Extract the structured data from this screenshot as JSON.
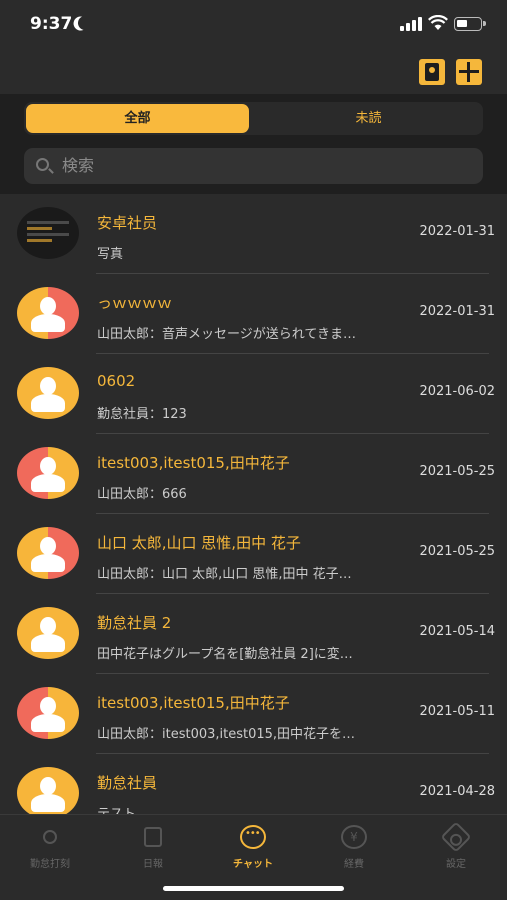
{
  "status": {
    "time": "9:37"
  },
  "segments": {
    "all": "全部",
    "unread": "未読"
  },
  "search": {
    "placeholder": "検索"
  },
  "chats": [
    {
      "title": "安卓社员",
      "subtitle": "写真",
      "date": "2022-01-31",
      "avatar": "photo"
    },
    {
      "title": "っｗｗｗｗ",
      "subtitle": "山田太郎：音声メッセージが送られてきま…",
      "date": "2022-01-31",
      "avatar": "split"
    },
    {
      "title": "0602",
      "subtitle": "勤怠社員：123",
      "date": "2021-06-02",
      "avatar": "orange"
    },
    {
      "title": "itest003,itest015,田中花子",
      "subtitle": "山田太郎：666",
      "date": "2021-05-25",
      "avatar": "split-red"
    },
    {
      "title": "山口 太郎,山口 思惟,田中 花子",
      "subtitle": "山田太郎：山口 太郎,山口 思惟,田中 花子…",
      "date": "2021-05-25",
      "avatar": "split"
    },
    {
      "title": "勤怠社員 2",
      "subtitle": "田中花子はグループ名を[勤怠社員 2]に変…",
      "date": "2021-05-14",
      "avatar": "orange"
    },
    {
      "title": "itest003,itest015,田中花子",
      "subtitle": "山田太郎：itest003,itest015,田中花子を…",
      "date": "2021-05-11",
      "avatar": "split-red"
    },
    {
      "title": "勤怠社員",
      "subtitle": "テスト",
      "date": "2021-04-28",
      "avatar": "orange"
    }
  ],
  "tabs": [
    {
      "label": "勤怠打刻",
      "icon": "sun-icon"
    },
    {
      "label": "日報",
      "icon": "report-icon"
    },
    {
      "label": "チャット",
      "icon": "chat-icon",
      "active": true
    },
    {
      "label": "経費",
      "icon": "yen-icon"
    },
    {
      "label": "設定",
      "icon": "gear-icon"
    }
  ]
}
